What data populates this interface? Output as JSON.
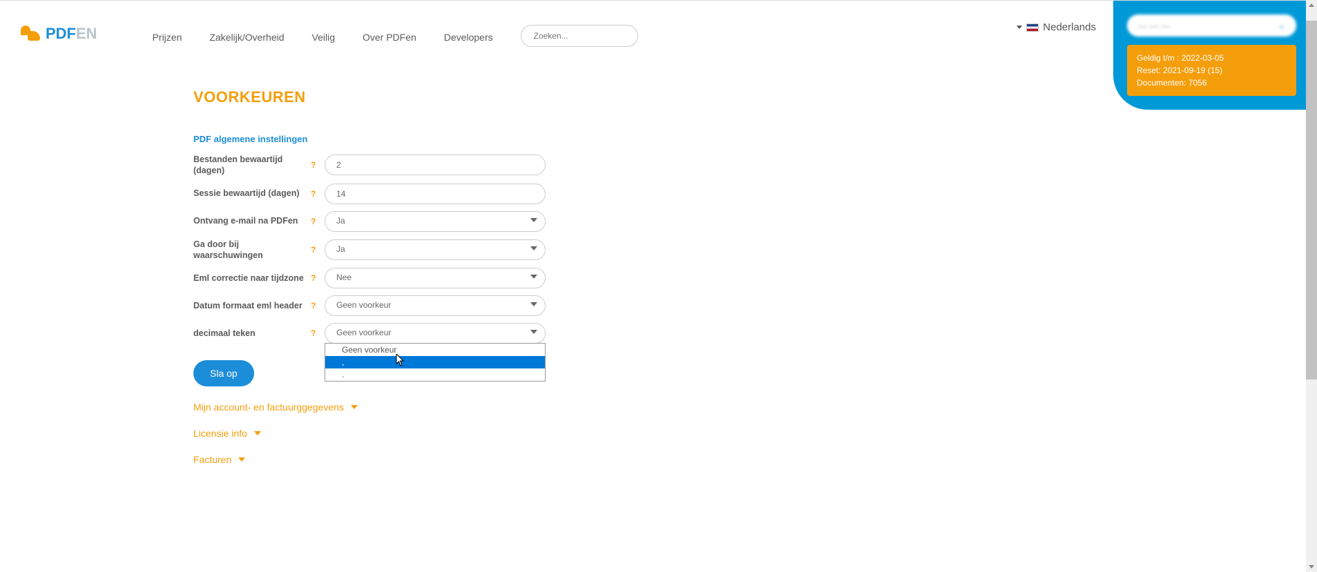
{
  "logo": {
    "blue": "PDF",
    "gray": "EN"
  },
  "nav": [
    "Prijzen",
    "Zakelijk/Overheid",
    "Veilig",
    "Over PDFen",
    "Developers"
  ],
  "search": {
    "placeholder": "Zoeken..."
  },
  "language": "Nederlands",
  "user_panel": {
    "valid": "Geldig t/m : 2022-03-05",
    "reset": "Reset: 2021-09-19 (15)",
    "docs": "Documenten: 7056"
  },
  "page_title": "VOORKEUREN",
  "section_title": "PDF algemene instellingen",
  "fields": {
    "retention_label": "Bestanden bewaartijd (dagen)",
    "retention_value": "2",
    "session_label": "Sessie bewaartijd (dagen)",
    "session_value": "14",
    "email_label": "Ontvang e-mail na PDFen",
    "email_value": "Ja",
    "continue_label": "Ga door bij waarschuwingen",
    "continue_value": "Ja",
    "eml_label": "Eml correctie naar tijdzone",
    "eml_value": "Nee",
    "date_label": "Datum formaat eml header",
    "date_value": "Geen voorkeur",
    "decimal_label": "decimaal teken",
    "decimal_value": "Geen voorkeur",
    "decimal_options": [
      "Geen voorkeur",
      ",",
      "."
    ]
  },
  "save_button": "Sla op",
  "accordion": {
    "account": "Mijn account- en factuurggegevens",
    "license": "Licensie info",
    "invoices": "Facturen"
  },
  "help_char": "?"
}
